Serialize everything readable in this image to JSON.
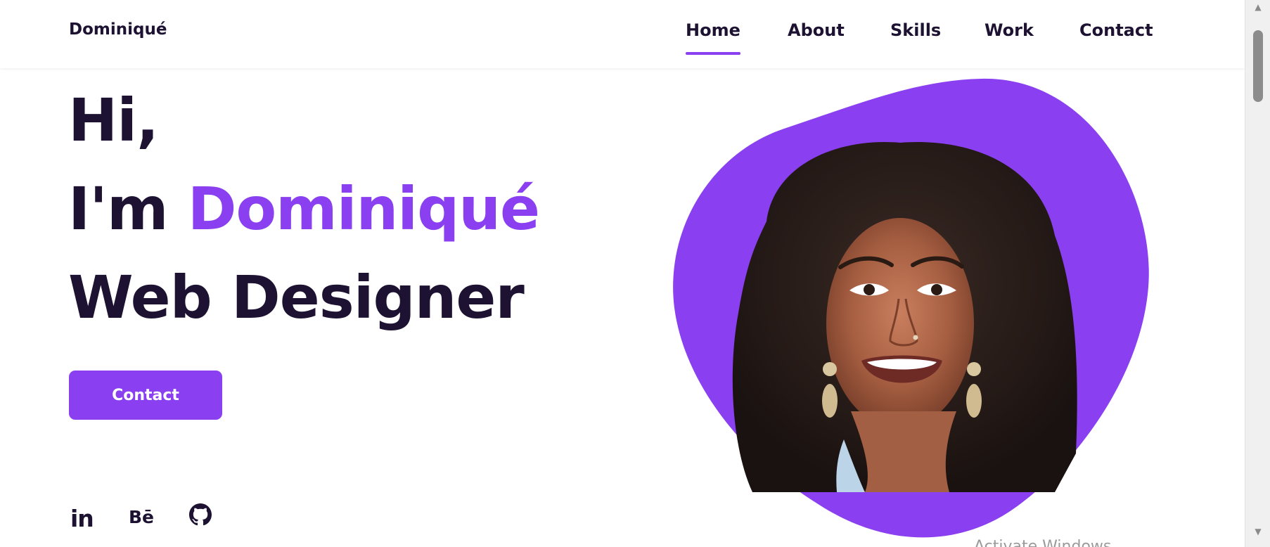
{
  "header": {
    "logo": "Dominiqué",
    "nav": [
      {
        "label": "Home",
        "active": true
      },
      {
        "label": "About",
        "active": false
      },
      {
        "label": "Skills",
        "active": false
      },
      {
        "label": "Work",
        "active": false
      },
      {
        "label": "Contact",
        "active": false
      }
    ]
  },
  "hero": {
    "greeting": "Hi,",
    "intro_prefix": "I'm ",
    "name": "Dominiqué",
    "role": "Web Designer",
    "cta_label": "Contact"
  },
  "socials": [
    {
      "label": "in",
      "icon": "linkedin-icon"
    },
    {
      "label": "Bē",
      "icon": "behance-icon"
    },
    {
      "label": "",
      "icon": "github-icon"
    }
  ],
  "overlay": {
    "watermark": "Activate Windows"
  },
  "colors": {
    "accent": "#8a3ff0",
    "text_dark": "#1d1232",
    "background": "#ffffff"
  }
}
